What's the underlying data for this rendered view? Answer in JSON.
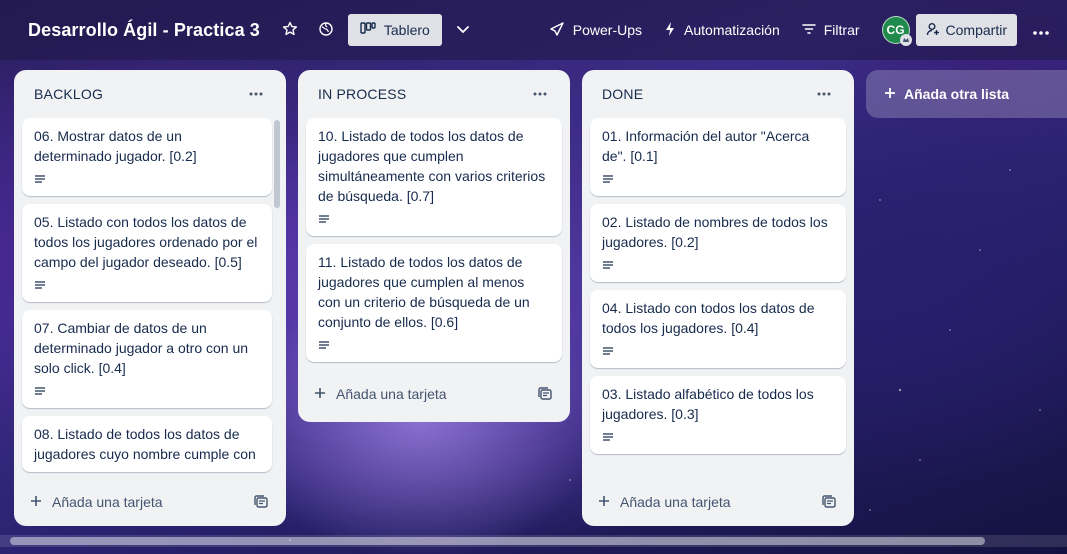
{
  "header": {
    "board_title": "Desarrollo Ágil - Practica 3",
    "view_label": "Tablero",
    "powerups_label": "Power-Ups",
    "automation_label": "Automatización",
    "filter_label": "Filtrar",
    "avatar_initials": "CG",
    "share_label": "Compartir",
    "icons": [
      "star-icon",
      "globe-icon",
      "board-icon",
      "chevron-down-icon",
      "rocket-icon",
      "lightning-icon",
      "filter-icon",
      "share-user-icon",
      "more-icon"
    ]
  },
  "lists": [
    {
      "title": "BACKLOG",
      "cards": [
        {
          "text": "06. Mostrar datos de un determinado jugador. [0.2]"
        },
        {
          "text": "05. Listado con todos los datos de todos los jugadores ordenado por el campo del jugador deseado. [0.5]"
        },
        {
          "text": "07. Cambiar de datos de un determinado jugador a otro con un solo click. [0.4]"
        },
        {
          "text": "08. Listado de todos los datos de jugadores cuyo nombre cumple con"
        }
      ],
      "add_card_label": "Añada una tarjeta"
    },
    {
      "title": "IN PROCESS",
      "cards": [
        {
          "text": "10. Listado de todos los datos de jugadores que cumplen simultáneamente con varios criterios de búsqueda. [0.7]"
        },
        {
          "text": "11. Listado de todos los datos de jugadores que cumplen al menos con un criterio de búsqueda de un conjunto de ellos. [0.6]"
        }
      ],
      "add_card_label": "Añada una tarjeta"
    },
    {
      "title": "DONE",
      "cards": [
        {
          "text": "01. Información del autor \"Acerca de\". [0.1]"
        },
        {
          "text": "02. Listado de nombres de todos los jugadores. [0.2]"
        },
        {
          "text": "04. Listado con todos los datos de todos los jugadores. [0.4]"
        },
        {
          "text": "03. Listado alfabético de todos los jugadores. [0.3]"
        }
      ],
      "add_card_label": "Añada una tarjeta"
    }
  ],
  "add_list_label": "Añada otra lista",
  "colors": {
    "header_bg": "#1e1846",
    "list_bg": "#f1f2f4",
    "card_bg": "#ffffff",
    "text": "#172b4d",
    "avatar": "#1f8a4c"
  }
}
